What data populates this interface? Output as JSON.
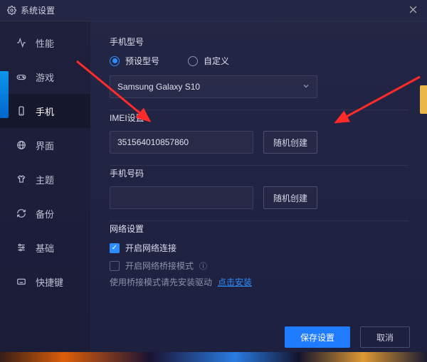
{
  "title": "系统设置",
  "sidebar": {
    "items": [
      {
        "label": "性能"
      },
      {
        "label": "游戏"
      },
      {
        "label": "手机"
      },
      {
        "label": "界面"
      },
      {
        "label": "主题"
      },
      {
        "label": "备份"
      },
      {
        "label": "基础"
      },
      {
        "label": "快捷键"
      }
    ]
  },
  "content": {
    "model_label": "手机型号",
    "radio_preset": "预设型号",
    "radio_custom": "自定义",
    "model_value": "Samsung Galaxy S10",
    "imei_label": "IMEI设置",
    "imei_value": "351564010857860",
    "random_btn": "随机创建",
    "phone_label": "手机号码",
    "phone_value": "",
    "network_label": "网络设置",
    "net_enable": "开启网络连接",
    "net_bridge": "开启网络桥接模式",
    "bridge_hint_prefix": "使用桥接模式请先安装驱动",
    "bridge_link": "点击安装"
  },
  "footer": {
    "save": "保存设置",
    "cancel": "取消"
  }
}
